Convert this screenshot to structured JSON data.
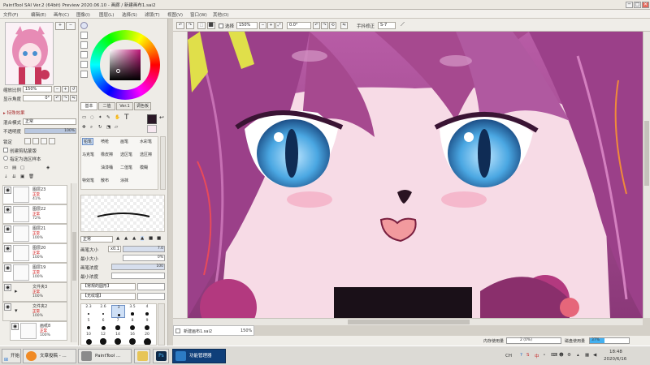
{
  "window": {
    "title": "PaintTool SAI Ver.2 (64bit) Preview 2020.06.10 - 画廊 / 新建画布1.sai2",
    "min": "─",
    "max": "□",
    "close": "✕"
  },
  "menu": [
    "文件(F)",
    "编辑(E)",
    "画布(C)",
    "图像(I)",
    "图层(L)",
    "选择(S)",
    "滤镜(T)",
    "视图(V)",
    "窗口(W)",
    "其他(O)"
  ],
  "navigator": {
    "zoom_label": "缩放比例",
    "zoom_value": "150%",
    "angle_label": "显示角度",
    "angle_value": "0°"
  },
  "layer_panel": {
    "effects_label": "▸ 特殊效果",
    "blend_label": "混合模式",
    "blend_value": "正常",
    "opacity_label": "不透明度",
    "opacity_value": "100%",
    "lock_label": "锁定",
    "clip_label": "创建剪贴蒙版",
    "select_source_label": "指定为选区样本",
    "layers": [
      {
        "name": "图层23",
        "mode": "正常",
        "opacity": "41%"
      },
      {
        "name": "图层22",
        "mode": "正常",
        "opacity": "72%"
      },
      {
        "name": "图层21",
        "mode": "正常",
        "opacity": "100%"
      },
      {
        "name": "图层20",
        "mode": "正常",
        "opacity": "100%"
      },
      {
        "name": "图层19",
        "mode": "正常",
        "opacity": "100%"
      },
      {
        "name": "文件夹3",
        "mode": "正常",
        "opacity": "100%"
      },
      {
        "name": "文件夹2",
        "mode": "正常",
        "opacity": "100%"
      },
      {
        "name": "画纸8",
        "mode": "正常",
        "opacity": "100%"
      }
    ]
  },
  "color_panel": {
    "current_color": "#2a1726",
    "tabs": [
      "基本",
      "二值",
      "Ver.1",
      "调色板"
    ],
    "text_tool": "T"
  },
  "tools": {
    "row1": [
      "铅笔",
      "喷枪",
      "画笔",
      "水彩笔"
    ],
    "row2": [
      "马克笔",
      "橡皮擦",
      "选区笔",
      "选区擦"
    ],
    "row3": [
      "油漆桶",
      "二值笔",
      "模糊",
      "涂抹"
    ],
    "row4": [
      "特效笔",
      "散布",
      "涂抹"
    ]
  },
  "brush": {
    "mode_label": "正常",
    "size_label": "画笔大小",
    "size_mult": "x0.1",
    "size_value": "7.0",
    "min_size_label": "最小大小",
    "min_size_value": "0%",
    "density_label": "画笔浓度",
    "density_value": "100",
    "min_density_label": "最小浓度",
    "min_density_value": "",
    "shape_label": "【常规的圆形】",
    "texture_label": "【无纹理】",
    "sizes": [
      "2.3",
      "2.6",
      "3",
      "3.5",
      "4",
      "5",
      "6",
      "7",
      "8",
      "9",
      "10",
      "12",
      "14",
      "16",
      "20",
      "25",
      "30",
      "35",
      "40",
      "50"
    ]
  },
  "canvas_bar": {
    "select_label": "选择",
    "zoom_value": "150%",
    "angle_value": "0.0°",
    "stabilizer_label": "手抖修正",
    "stabilizer_value": "S-7"
  },
  "document": {
    "name": "新建画布1.sai2",
    "zoom": "150%"
  },
  "status": {
    "memory_label": "内存使用量",
    "memory_value": "2 (0%)",
    "memory_pct": 0.0,
    "disk_label": "磁盘使用量",
    "disk_value": "37%",
    "disk_pct": 0.37
  },
  "taskbar": {
    "start": "开始",
    "tasks": [
      "文章投稿 - ...",
      "PaintTool ...",
      "",
      "",
      "功能管理器"
    ],
    "lang": "CH",
    "tray_text": "中",
    "time": "18:48",
    "date": "2020/6/16"
  }
}
